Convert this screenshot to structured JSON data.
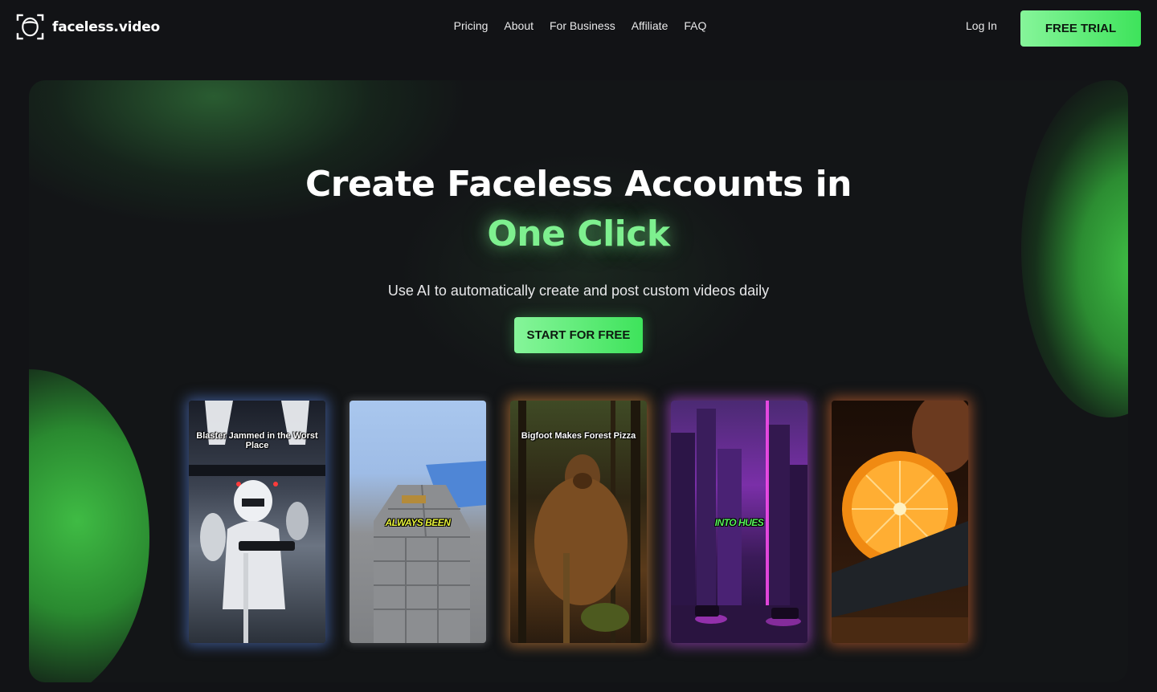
{
  "brand": {
    "name": "faceless.video"
  },
  "nav": {
    "links": [
      "Pricing",
      "About",
      "For Business",
      "Affiliate",
      "FAQ"
    ],
    "login_label": "Log In",
    "trial_label": "FREE TRIAL"
  },
  "hero": {
    "headline": "Create Faceless Accounts in",
    "headline_accent": "One Click",
    "subtitle": "Use AI to automatically create and post custom videos daily",
    "cta_label": "START FOR FREE"
  },
  "cards": [
    {
      "caption": "Blaster Jammed in the Worst Place",
      "sticker": ""
    },
    {
      "caption": "",
      "sticker": "ALWAYS BEEN"
    },
    {
      "caption": "Bigfoot Makes Forest Pizza",
      "sticker": ""
    },
    {
      "caption": "",
      "sticker": "INTO HUES"
    },
    {
      "caption": "",
      "sticker": ""
    }
  ],
  "colors": {
    "accent": "#7ef08f",
    "button": "#3ee35b",
    "background": "#121316",
    "sticker_yellow": "#e6f23a",
    "sticker_green": "#56f05a"
  },
  "icons": {
    "logo": "face-frame-icon"
  }
}
